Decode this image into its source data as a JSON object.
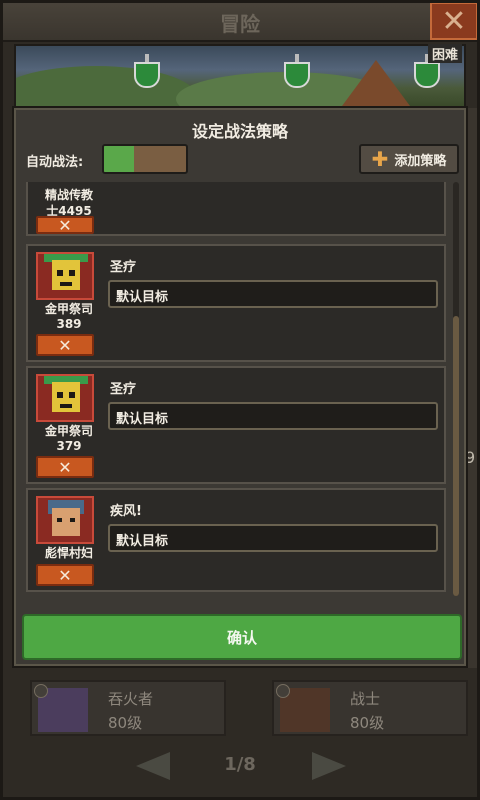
{
  "header": {
    "title": "冒险",
    "close_icon": "close-icon"
  },
  "banner": {
    "difficulty": "困难"
  },
  "background": {
    "partial_number": "9",
    "cards": [
      {
        "name": "吞火者",
        "level": "80级"
      },
      {
        "name": "战士",
        "level": "80级"
      }
    ],
    "pager": {
      "page": "1/8"
    }
  },
  "modal": {
    "title": "设定战法策略",
    "auto_label": "自动战法:",
    "auto_enabled": true,
    "add_button": {
      "label": "添加策略",
      "icon": "plus-icon"
    },
    "strategies": [
      {
        "unit_name": "精战传教士4495",
        "unit_name_l1": "精战传教",
        "unit_name_l2": "士4495",
        "skill": "",
        "target": "",
        "portrait": "preacher",
        "remove": "✕"
      },
      {
        "unit_name_l1": "金甲祭司",
        "unit_name_l2": "389",
        "skill": "圣疗",
        "target": "默认目标",
        "portrait": "golden-priest",
        "remove": "✕"
      },
      {
        "unit_name_l1": "金甲祭司",
        "unit_name_l2": "379",
        "skill": "圣疗",
        "target": "默认目标",
        "portrait": "golden-priest",
        "remove": "✕"
      },
      {
        "unit_name_l1": "彪悍村妇",
        "unit_name_l2": "",
        "skill": "疾风!",
        "target": "默认目标",
        "portrait": "village-woman",
        "remove": "✕"
      }
    ],
    "confirm_label": "确认"
  },
  "colors": {
    "confirm_green": "#4ea844",
    "remove_orange": "#c85820",
    "toggle_on": "#5aa84a",
    "panel_bg": "#3c3934"
  }
}
